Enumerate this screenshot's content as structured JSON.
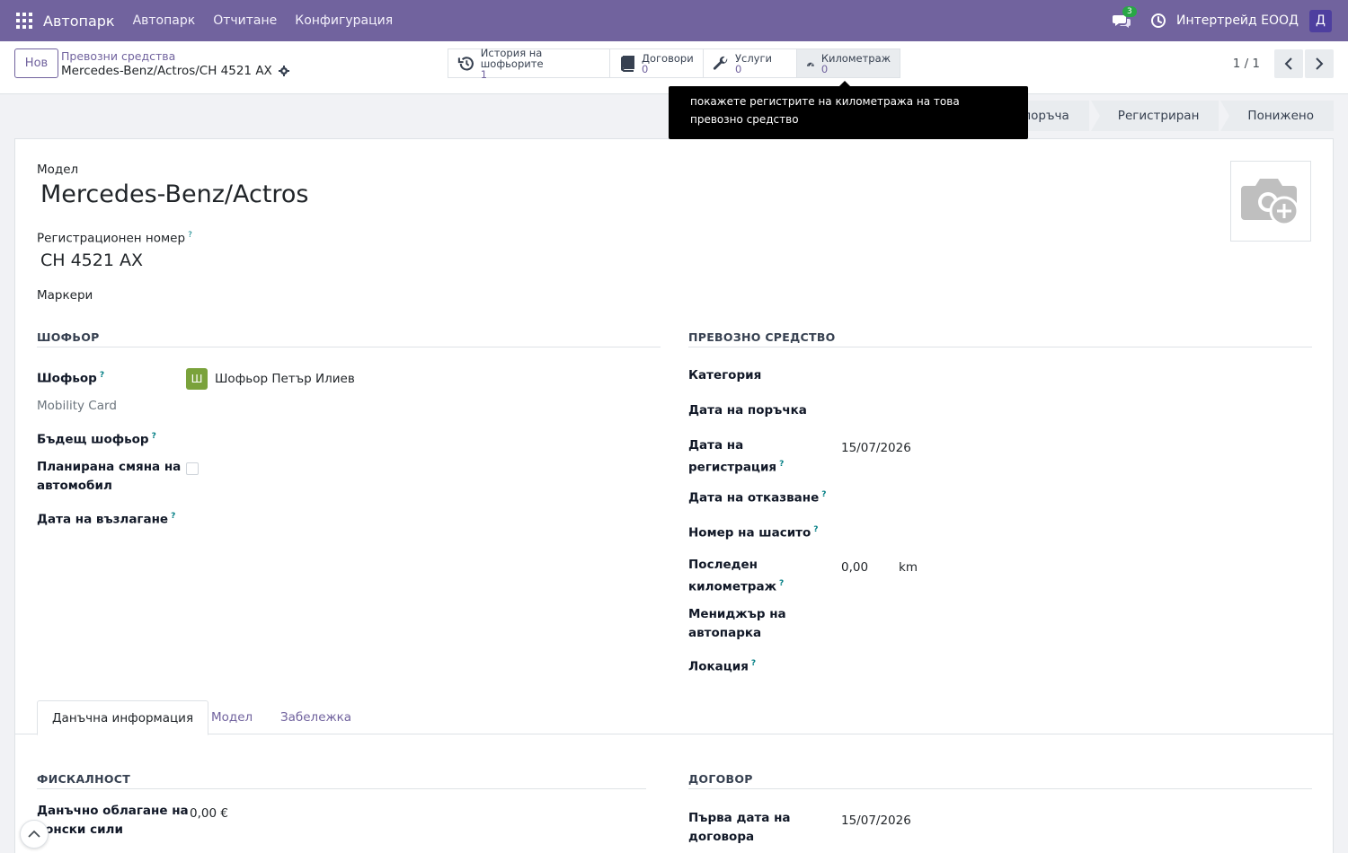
{
  "navbar": {
    "app_name": "Автопарк",
    "menus": [
      "Автопарк",
      "Отчитане",
      "Конфигурация"
    ],
    "chat_count": "3",
    "company": "Интертрейд ЕООД",
    "user_initial": "Д",
    "accent_color": "#71639e"
  },
  "control": {
    "new_button": "Нов",
    "breadcrumb_parent": "Превозни средства",
    "breadcrumb_current": "Mercedes-Benz/Actros/CH 4521 AX",
    "smart_buttons": [
      {
        "label": "История на шофьорите",
        "count": "1",
        "icon": "history-icon"
      },
      {
        "label": "Договори",
        "count": "0",
        "icon": "book-icon"
      },
      {
        "label": "Услуги",
        "count": "0",
        "icon": "wrench-icon"
      },
      {
        "label": "Километраж",
        "count": "0",
        "icon": "tachometer-icon"
      }
    ],
    "pager": "1 / 1"
  },
  "tooltip": {
    "text": "покажете регистрите на километража на това превозно средство"
  },
  "statusbar": {
    "stages": [
      "Да поръча",
      "Регистриран",
      "Понижено"
    ]
  },
  "form": {
    "model_label": "Модел",
    "model_value": "Mercedes-Benz/Actros",
    "reg_label": "Регистрационен номер",
    "reg_value": "CH 4521 AX",
    "tags_label": "Маркери",
    "help_mark": "?",
    "driver_section": {
      "title": "ШОФЬОР",
      "driver_label": "Шофьор",
      "driver_initial": "Ш",
      "driver_value": "Шофьор Петър Илиев",
      "mobility_card_label": "Mobility Card",
      "future_driver_label": "Бъдещ шофьор",
      "planned_change_label_1": "Планирана смяна на",
      "planned_change_label_2": "автомобил",
      "assignment_date_label": "Дата на възлагане"
    },
    "vehicle_section": {
      "title": "ПРЕВОЗНО СРЕДСТВО",
      "category_label": "Категория",
      "order_date_label": "Дата на поръчка",
      "registration_date_label_1": "Дата на",
      "registration_date_label_2": "регистрация",
      "registration_date_value": "15/07/2026",
      "cancellation_date_label": "Дата на отказване",
      "chassis_label": "Номер на шасито",
      "last_odometer_label_1": "Последен",
      "last_odometer_label_2": "километраж",
      "last_odometer_value": "0,00",
      "last_odometer_unit": "km",
      "fleet_manager_label_1": "Мениджър на",
      "fleet_manager_label_2": "автопарка",
      "location_label": "Локация"
    },
    "tabs": [
      "Данъчна информация",
      "Модел",
      "Забележка"
    ],
    "fiscal_section": {
      "title": "ФИСКАЛНОСТ",
      "horsepower_tax_label_1": "Данъчно облагане на",
      "horsepower_tax_label_2": "конски сили",
      "horsepower_tax_value": "0,00 €"
    },
    "contract_section": {
      "title": "ДОГОВОР",
      "first_contract_label_1": "Първа дата на",
      "first_contract_label_2": "договора",
      "first_contract_value": "15/07/2026"
    }
  }
}
